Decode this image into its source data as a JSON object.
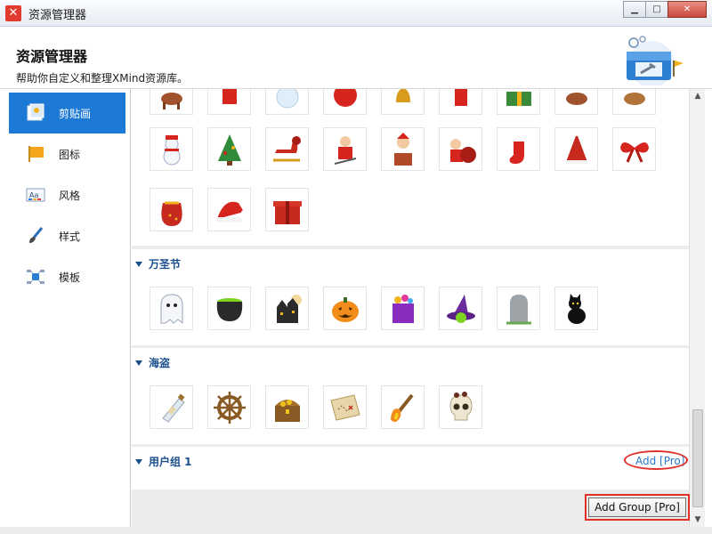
{
  "window": {
    "title": "资源管理器",
    "app_icon": "xmind-icon",
    "buttons": [
      "minimize-icon",
      "maximize-icon",
      "close-icon"
    ]
  },
  "header": {
    "title": "资源管理器",
    "subtitle": "帮助你自定义和整理XMind资源库。"
  },
  "sidebar": {
    "items": [
      {
        "label": "剪贴画",
        "icon": "clipart-icon",
        "active": true
      },
      {
        "label": "图标",
        "icon": "flag-icon",
        "active": false
      },
      {
        "label": "风格",
        "icon": "style-icon",
        "active": false
      },
      {
        "label": "样式",
        "icon": "brush-icon",
        "active": false
      },
      {
        "label": "模板",
        "icon": "template-icon",
        "active": false
      }
    ]
  },
  "groups": [
    {
      "name": "",
      "note": "partially scrolled christmas group",
      "items": [
        "reindeer",
        "santa",
        "snowman-globe",
        "ornament",
        "bells",
        "santa-small",
        "gift-box",
        "reindeer",
        "reindeer",
        "snowman",
        "christmas-tree",
        "sleigh",
        "santa-skiing",
        "santa-chimney",
        "santa-sack",
        "stocking",
        "santa-hat-tree",
        "bow",
        "gift-sack",
        "santa-hat",
        "red-gift"
      ]
    },
    {
      "name": "万圣节",
      "items": [
        "ghost",
        "cauldron",
        "haunted-house",
        "pumpkin",
        "candy-bag",
        "witch-hat",
        "tombstone",
        "black-cat"
      ]
    },
    {
      "name": "海盗",
      "items": [
        "message-bottle",
        "ship-wheel",
        "treasure-chest",
        "treasure-map",
        "torch",
        "skull"
      ]
    },
    {
      "name": "用户组 1",
      "items": [],
      "add_label": "Add [Pro]"
    }
  ],
  "footer": {
    "add_group_label": "Add Group [Pro]"
  },
  "colors": {
    "accent": "#1c7ad6",
    "group_title": "#1a4e8c",
    "link": "#2b79c7",
    "highlight": "#e0302a"
  }
}
